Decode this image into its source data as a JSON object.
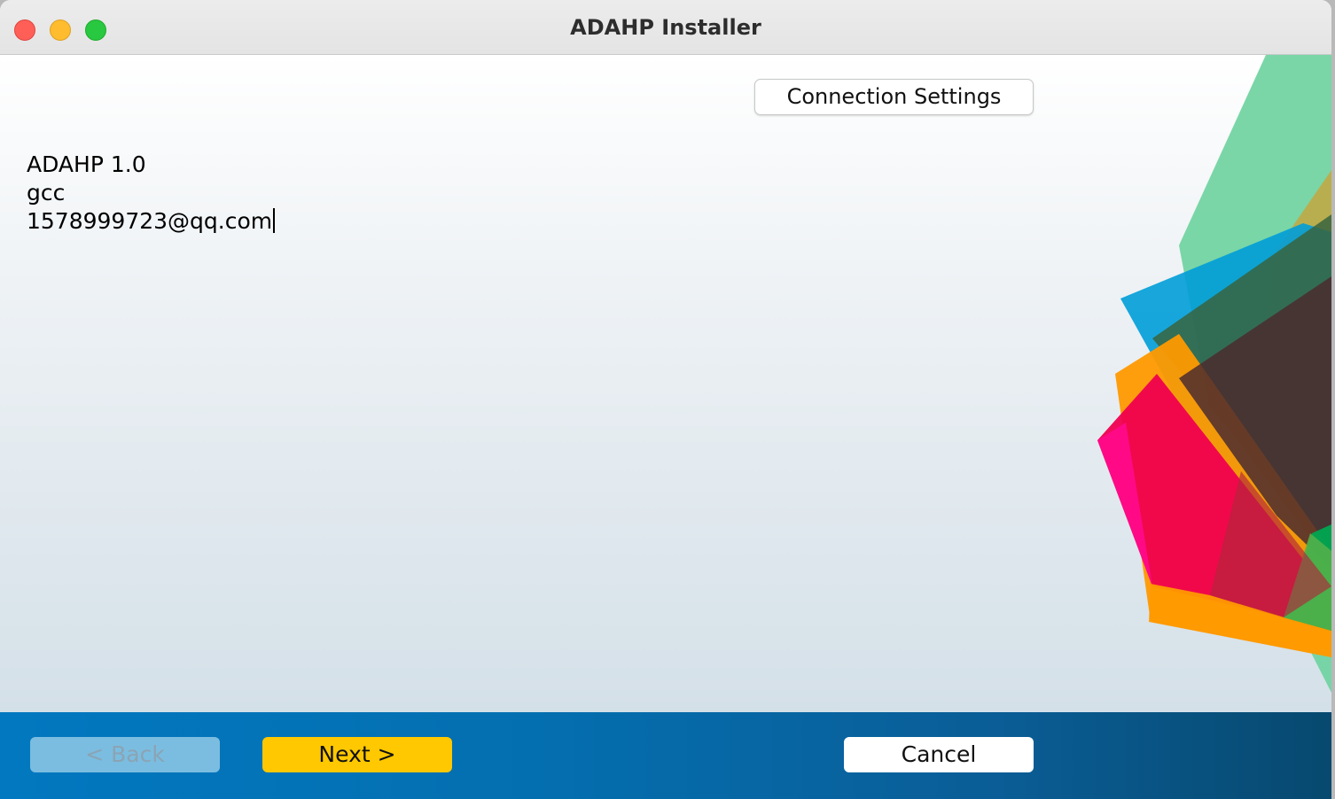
{
  "window": {
    "title": "ADAHP Installer"
  },
  "toolbar": {
    "connection_settings_label": "Connection Settings"
  },
  "info": {
    "product": "ADAHP 1.0",
    "user": "gcc",
    "email": "1578999723@qq.com"
  },
  "footer": {
    "back_label": "< Back",
    "back_enabled": false,
    "next_label": "Next >",
    "cancel_label": "Cancel"
  },
  "colors": {
    "footer_bar": "#046fb0",
    "next_button": "#ffc800",
    "back_button_disabled": "#7bbde0",
    "traffic_close": "#ff5f57",
    "traffic_minimize": "#febc2e",
    "traffic_zoom": "#28c840"
  }
}
